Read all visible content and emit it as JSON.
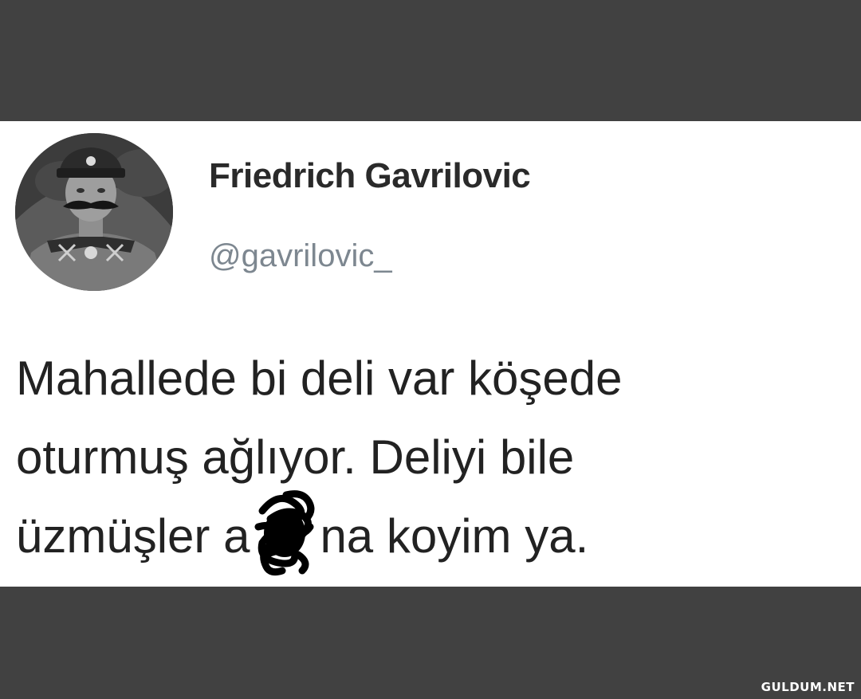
{
  "tweet": {
    "display_name": "Friedrich Gavrilovic",
    "handle": "@gavrilovic_",
    "text_lines": [
      "Mahallede bi deli var köşede",
      "oturmuş ağlıyor. Deliyi bile"
    ],
    "text_line3_before": "üzmüşler a",
    "text_line3_after": "na koyim ya."
  },
  "watermark": "GULDUM.NET",
  "colors": {
    "background": "#414141",
    "card": "#ffffff",
    "name": "#2a2a2a",
    "handle": "#7d8790",
    "text": "#222222"
  }
}
